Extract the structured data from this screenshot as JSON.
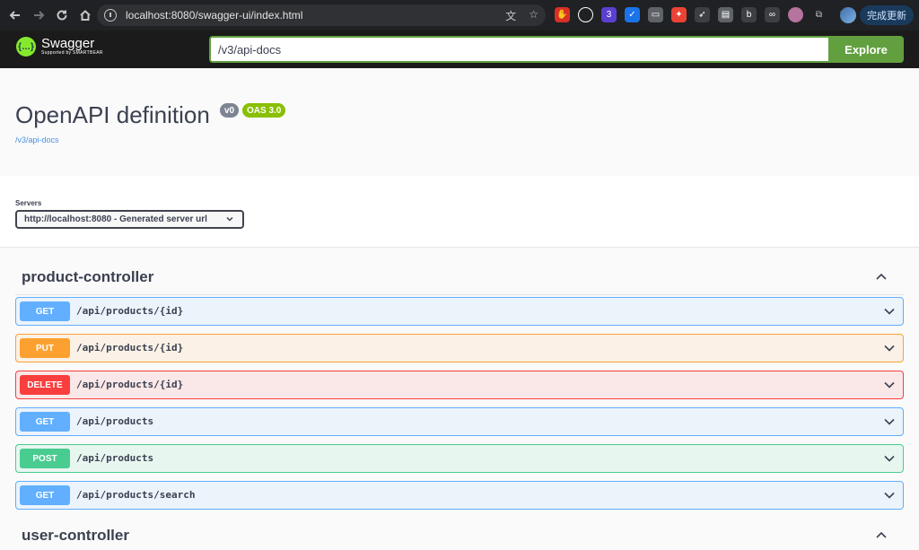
{
  "browser": {
    "url": "localhost:8080/swagger-ui/index.html",
    "update_label": "完成更新"
  },
  "topbar": {
    "logo_name": "Swagger",
    "logo_sub": "Supported by SMARTBEAR",
    "api_url": "/v3/api-docs",
    "explore_label": "Explore"
  },
  "info": {
    "title": "OpenAPI definition",
    "version": "v0",
    "oas": "OAS 3.0",
    "link": "/v3/api-docs"
  },
  "servers": {
    "label": "Servers",
    "selected": "http://localhost:8080 - Generated server url"
  },
  "tags": [
    {
      "name": "product-controller",
      "operations": [
        {
          "method": "GET",
          "path": "/api/products/{id}"
        },
        {
          "method": "PUT",
          "path": "/api/products/{id}"
        },
        {
          "method": "DELETE",
          "path": "/api/products/{id}"
        },
        {
          "method": "GET",
          "path": "/api/products"
        },
        {
          "method": "POST",
          "path": "/api/products"
        },
        {
          "method": "GET",
          "path": "/api/products/search"
        }
      ]
    },
    {
      "name": "user-controller",
      "operations": []
    }
  ],
  "colors": {
    "get": "#61affe",
    "put": "#fca130",
    "delete": "#f93e3e",
    "post": "#49cc90",
    "swagger_green": "#62a03f"
  }
}
